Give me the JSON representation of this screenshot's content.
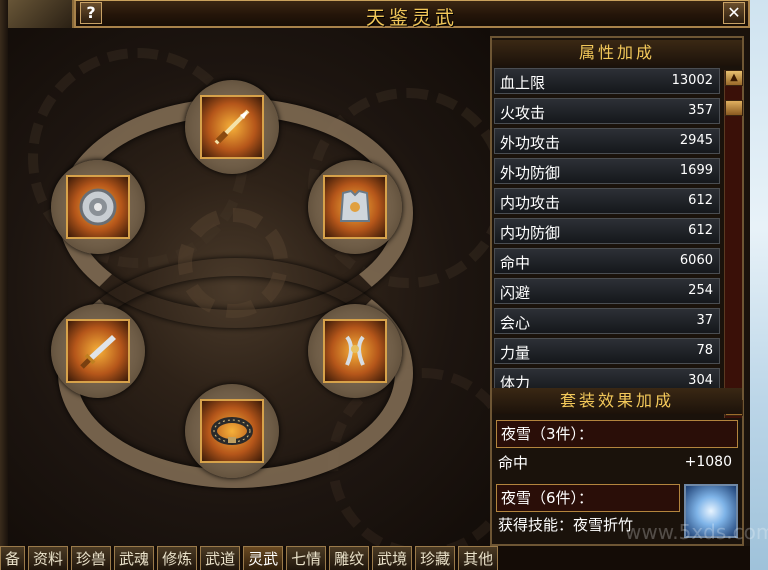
{
  "window": {
    "title": "天鉴灵武",
    "help_label": "?",
    "close_label": "✕"
  },
  "equipment_slots": [
    {
      "name": "spear",
      "icon": "spear-icon"
    },
    {
      "name": "armor",
      "icon": "armor-icon"
    },
    {
      "name": "amulet",
      "icon": "amulet-icon"
    },
    {
      "name": "belt",
      "icon": "belt-icon"
    },
    {
      "name": "dagger",
      "icon": "dagger-icon"
    },
    {
      "name": "ring",
      "icon": "ring-icon"
    }
  ],
  "attributes": {
    "header": "属性加成",
    "items": [
      {
        "label": "血上限",
        "value": "13002"
      },
      {
        "label": "火攻击",
        "value": "357"
      },
      {
        "label": "外功攻击",
        "value": "2945"
      },
      {
        "label": "外功防御",
        "value": "1699"
      },
      {
        "label": "内功攻击",
        "value": "612"
      },
      {
        "label": "内功防御",
        "value": "612"
      },
      {
        "label": "命中",
        "value": "6060"
      },
      {
        "label": "闪避",
        "value": "254"
      },
      {
        "label": "会心",
        "value": "37"
      },
      {
        "label": "力量",
        "value": "78"
      },
      {
        "label": "体力",
        "value": "304"
      }
    ],
    "scroll_up": "▲",
    "scroll_down": "▼"
  },
  "set_bonus": {
    "header": "套装效果加成",
    "set3_title": "夜雪（3件）：",
    "set3_stat_label": "命中",
    "set3_stat_value": "+1080",
    "set6_title": "夜雪（6件）：",
    "set6_skill_text": "获得技能：夜雪折竹",
    "skill_icon": "snow-bamboo-skill-icon"
  },
  "tabs": [
    "备",
    "资料",
    "珍兽",
    "武魂",
    "修炼",
    "武道",
    "灵武",
    "七情",
    "雕纹",
    "武境",
    "珍藏",
    "其他"
  ],
  "active_tab": "灵武",
  "watermark": "www.5xds.com"
}
